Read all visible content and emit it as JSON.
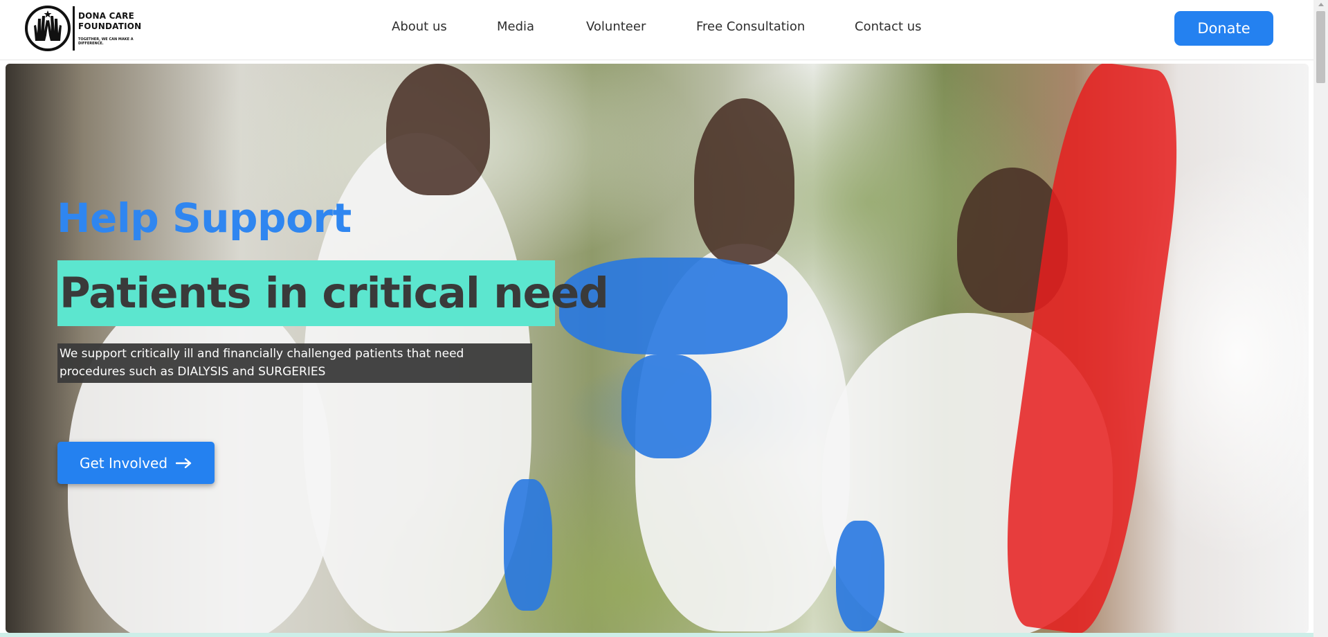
{
  "brand": {
    "name_line1": "DONA CARE",
    "name_line2": "FOUNDATION",
    "tagline": "TOGETHER, WE CAN MAKE A DIFFERENCE.",
    "logo_icon": "hands-raised-icon"
  },
  "nav": {
    "items": [
      {
        "label": "About us"
      },
      {
        "label": "Media"
      },
      {
        "label": "Volunteer"
      },
      {
        "label": "Free Consultation"
      },
      {
        "label": "Contact us"
      }
    ]
  },
  "header": {
    "donate_label": "Donate"
  },
  "hero": {
    "title": "Help Support",
    "highlight": "Patients in critical need",
    "description": "We support critically ill and financially challenged patients that need procedures such as DIALYSIS and SURGERIES",
    "cta_label": "Get Involved",
    "cta_icon": "arrow-right-icon",
    "image_subject": "volunteers-stacking-hands-photo"
  },
  "colors": {
    "accent": "#2481f0",
    "highlight_bg": "#5ce6cf",
    "title_blue": "#2f86f0",
    "desc_bg": "#3a3a3a"
  }
}
